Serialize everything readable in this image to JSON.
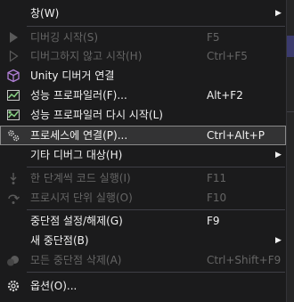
{
  "menu": {
    "window": {
      "label": "창(W)"
    },
    "start_debugging": {
      "label": "디버깅 시작(S)",
      "shortcut": "F5"
    },
    "start_without_debugging": {
      "label": "디버그하지 않고 시작(H)",
      "shortcut": "Ctrl+F5"
    },
    "attach_unity_debugger": {
      "label": "Unity 디버거 연결"
    },
    "performance_profiler": {
      "label": "성능 프로파일러(F)...",
      "shortcut": "Alt+F2"
    },
    "relaunch_performance_profiler": {
      "label": "성능 프로파일러 다시 시작(L)"
    },
    "attach_to_process": {
      "label": "프로세스에 연결(P)...",
      "shortcut": "Ctrl+Alt+P"
    },
    "other_debug_targets": {
      "label": "기타 디버그 대상(H)"
    },
    "step_into": {
      "label": "한 단계씩 코드 실행(I)",
      "shortcut": "F11"
    },
    "step_over": {
      "label": "프로시저 단위 실행(O)",
      "shortcut": "F10"
    },
    "toggle_breakpoint": {
      "label": "중단점 설정/해제(G)",
      "shortcut": "F9"
    },
    "new_breakpoint": {
      "label": "새 중단점(B)"
    },
    "delete_all_breakpoints": {
      "label": "모든 중단점 삭제(A)",
      "shortcut": "Ctrl+Shift+F9"
    },
    "options": {
      "label": "옵션(O)..."
    }
  },
  "colors": {
    "menu_background": "#1b1b1c",
    "text": "#f1f1f1",
    "disabled_text": "#656565",
    "highlight_background": "#333334",
    "highlight_border": "#8a8a8a",
    "unity_icon": "#b180d7",
    "profiler_icon": "#89d185"
  }
}
